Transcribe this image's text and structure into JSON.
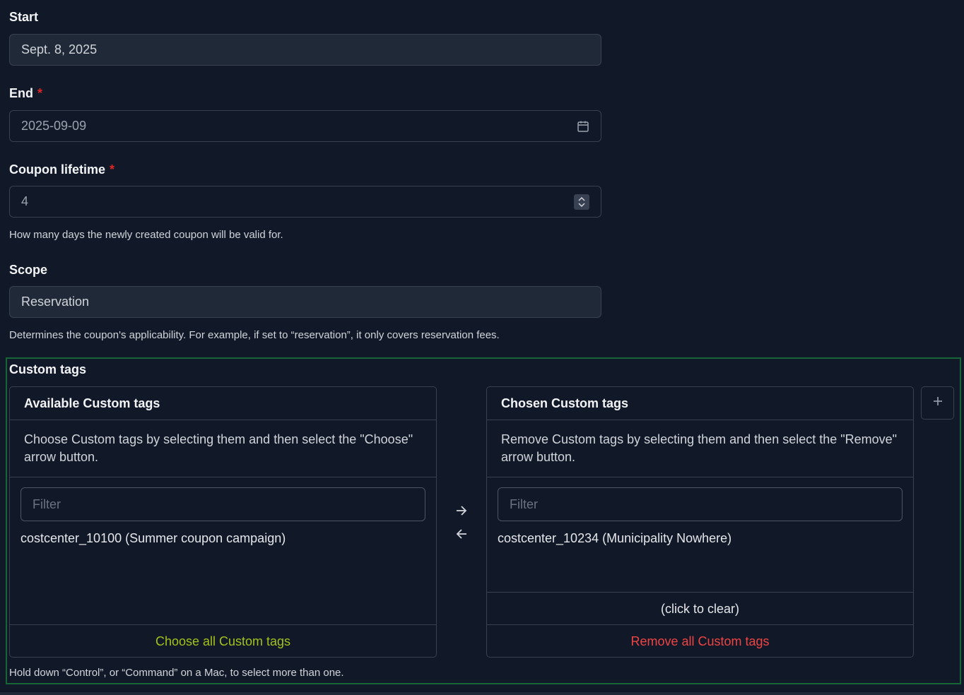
{
  "start": {
    "label": "Start",
    "value": "Sept. 8, 2025"
  },
  "end": {
    "label": "End",
    "required_mark": "*",
    "value": "2025-09-09",
    "icon": "calendar-icon"
  },
  "coupon_lifetime": {
    "label": "Coupon lifetime",
    "required_mark": "*",
    "value": "4",
    "help": "How many days the newly created coupon will be valid for."
  },
  "scope": {
    "label": "Scope",
    "value": "Reservation",
    "help": "Determines the coupon's applicability. For example, if set to “reservation”, it only covers reservation fees."
  },
  "custom_tags": {
    "label": "Custom tags",
    "available": {
      "title": "Available Custom tags",
      "description": "Choose Custom tags by selecting them and then select the \"Choose\" arrow button.",
      "filter_placeholder": "Filter",
      "options": [
        "costcenter_10100 (Summer coupon campaign)"
      ],
      "choose_all": "Choose all Custom tags"
    },
    "chosen": {
      "title": "Chosen Custom tags",
      "description": "Remove Custom tags by selecting them and then select the \"Remove\" arrow button.",
      "filter_placeholder": "Filter",
      "options": [
        "costcenter_10234 (Municipality Nowhere)"
      ],
      "clear": "(click to clear)",
      "remove_all": "Remove all Custom tags"
    },
    "help": "Hold down “Control”, or “Command” on a Mac, to select more than one."
  },
  "colors": {
    "background": "#111827",
    "border": "#374151",
    "required": "#dc2626",
    "choose_all": "#a3c21c",
    "remove_all": "#ef4444",
    "group_outline": "#166534"
  }
}
